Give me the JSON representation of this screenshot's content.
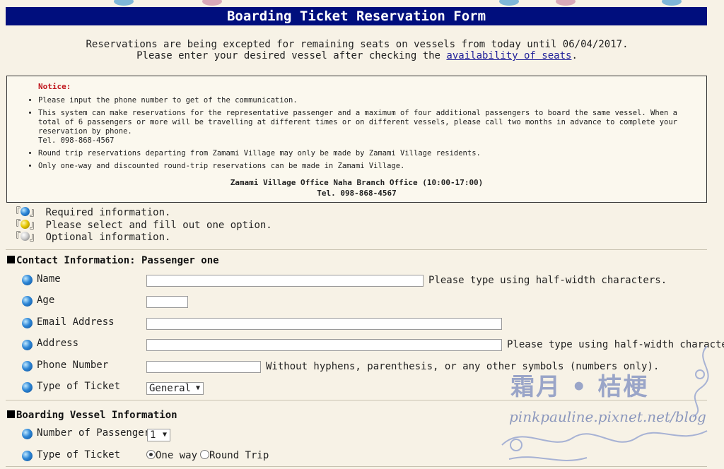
{
  "header": {
    "title": "Boarding Ticket Reservation Form"
  },
  "intro": {
    "line1_prefix": "Reservations are being excepted for remaining seats on vessels from today until ",
    "line1_date": "06/04/2017",
    "line1_suffix": ".",
    "line2_prefix": "Please enter your desired vessel after checking the ",
    "line2_link": "availability of seats",
    "line2_suffix": "."
  },
  "notice": {
    "title": "Notice:",
    "items": [
      "Please input the phone number to get of the communication.",
      "This system can make reservations for the representative passenger and a maximum of four additional passengers to board the same vessel. When a total of 6 passengers or more will be travelling at different times or on different vessels, please call two months in advance to complete your reservation by phone.",
      "Tel. 098-868-4567",
      "Round trip reservations departing from Zamami Village may only be made by Zamami Village residents.",
      "Only one-way and discounted round-trip reservations can be made in Zamami Village."
    ],
    "office": "Zamami Village Office Naha Branch Office (10:00-17:00)",
    "office_tel": "Tel. 098-868-4567"
  },
  "legend": {
    "required": "Required information.",
    "select_one": "Please select and fill out one option.",
    "optional": "Optional information.",
    "bracket_open": "『",
    "bracket_close": "』",
    "colors": {
      "required": "#2d86d6",
      "select_one": "#e6c800",
      "optional": "#cfcfcf"
    }
  },
  "contact": {
    "section_title": "Contact Information: Passenger one",
    "name_label": "Name",
    "name_hint": "Please type using half-width characters.",
    "age_label": "Age",
    "email_label": "Email Address",
    "address_label": "Address",
    "address_hint": "Please type using half-width characte",
    "phone_label": "Phone Number",
    "phone_hint": "Without hyphens, parenthesis, or any other symbols (numbers only).",
    "ticket_label": "Type of Ticket",
    "ticket_value": "General"
  },
  "vessel": {
    "section_title": "Boarding Vessel Information",
    "passengers_label": "Number of Passengers",
    "passengers_value": "1",
    "ticket_label": "Type of Ticket",
    "one_way": "One way",
    "round_trip": "Round Trip"
  },
  "watermark": {
    "name": "霜月 • 桔梗",
    "url": "pinkpauline.pixnet.net/blog"
  },
  "colors": {
    "title_bar": "#000e7d",
    "notice_title": "#c0161d",
    "link": "#22229a"
  }
}
